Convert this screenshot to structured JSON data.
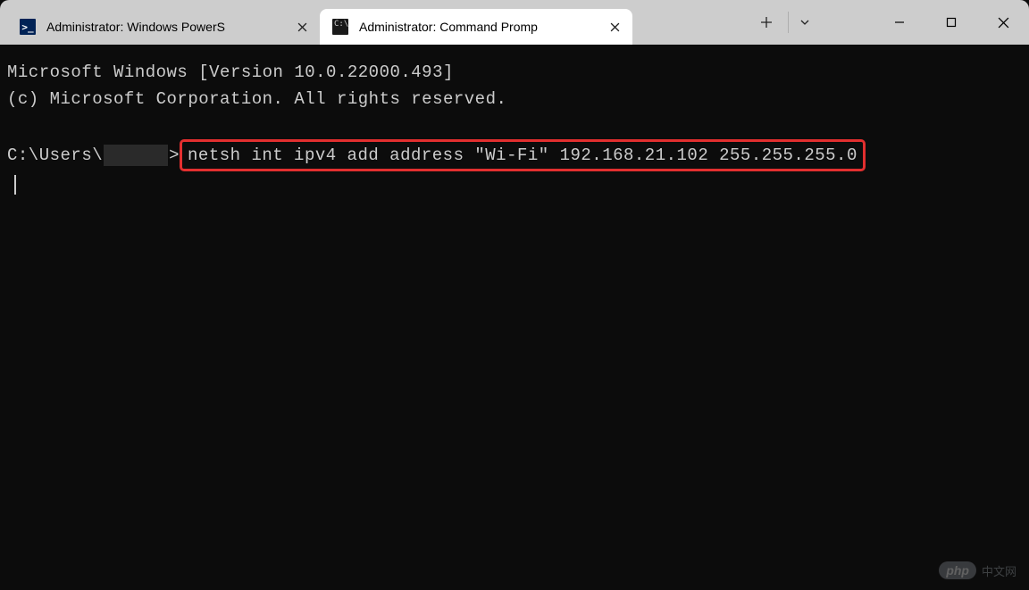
{
  "tabs": [
    {
      "title": "Administrator: Windows PowerS",
      "icon": "powershell"
    },
    {
      "title": "Administrator: Command Promp",
      "icon": "cmd"
    }
  ],
  "terminal": {
    "line1": "Microsoft Windows [Version 10.0.22000.493]",
    "line2": "(c) Microsoft Corporation. All rights reserved.",
    "prompt_prefix": "C:\\Users\\",
    "prompt_suffix": ">",
    "command": "netsh int ipv4 add address \"Wi-Fi\" 192.168.21.102 255.255.255.0"
  },
  "watermark": {
    "badge": "php",
    "text": "中文网"
  }
}
